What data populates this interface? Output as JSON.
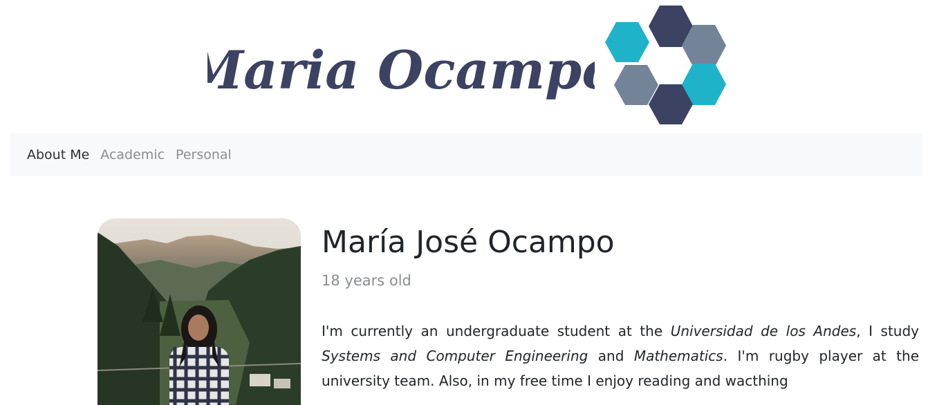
{
  "brand": {
    "name": "Maria Ocampo",
    "text_color": "#3c4262",
    "hex_colors": [
      "#3c4262",
      "#1fb3c9",
      "#738398"
    ]
  },
  "nav": {
    "items": [
      {
        "label": "About Me",
        "active": true
      },
      {
        "label": "Academic",
        "active": false
      },
      {
        "label": "Personal",
        "active": false
      }
    ]
  },
  "profile": {
    "name": "María José Ocampo",
    "age": "18 years old",
    "bio": {
      "t1": "I'm currently an undergraduate student at the ",
      "university": "Universidad de los Andes",
      "t2": ", I study ",
      "major1": "Systems and Computer Engineering",
      "t3": " and ",
      "major2": "Mathematics",
      "t4": ". I'm rugby player at the university team. Also, in my free time I enjoy reading and wacthing"
    }
  }
}
